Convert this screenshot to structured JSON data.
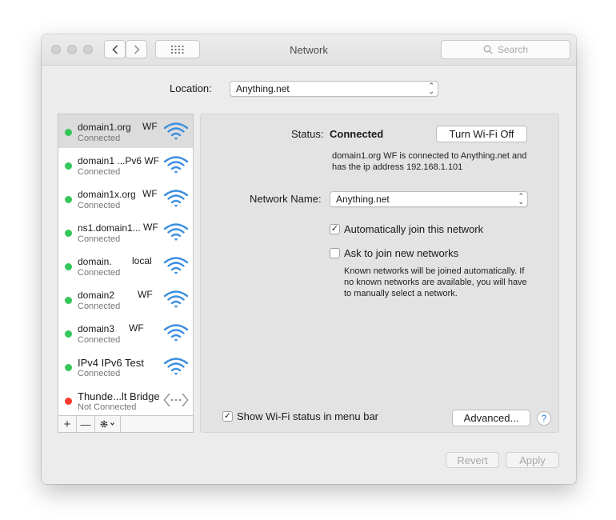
{
  "window": {
    "title": "Network",
    "search_placeholder": "Search"
  },
  "location": {
    "label": "Location:",
    "value": "Anything.net"
  },
  "services": [
    {
      "name": "domain1.org",
      "suffix": "WF",
      "status": "Connected",
      "icon": "wifi-icon",
      "state": "green",
      "selected": true
    },
    {
      "name": "domain1 ...Pv6 WF",
      "suffix": "",
      "status": "Connected",
      "icon": "wifi-icon",
      "state": "green",
      "selected": false
    },
    {
      "name": "domain1x.org",
      "suffix": "WF",
      "status": "Connected",
      "icon": "wifi-icon",
      "state": "green",
      "selected": false
    },
    {
      "name": "ns1.domain1...",
      "suffix": "WF",
      "status": "Connected",
      "icon": "wifi-icon",
      "state": "green",
      "selected": false
    },
    {
      "name": "domain.",
      "suffix": "local",
      "status": "Connected",
      "icon": "wifi-icon",
      "state": "green",
      "selected": false
    },
    {
      "name": "domain2",
      "suffix": "WF",
      "status": "Connected",
      "icon": "wifi-icon",
      "state": "green",
      "selected": false
    },
    {
      "name": "domain3",
      "suffix": "WF",
      "status": "Connected",
      "icon": "wifi-icon",
      "state": "green",
      "selected": false
    },
    {
      "name": "IPv4 IPv6 Test",
      "suffix": "",
      "status": "Connected",
      "icon": "wifi-icon",
      "state": "green",
      "selected": false
    },
    {
      "name": "Thunde...lt Bridge",
      "suffix": "",
      "status": "Not Connected",
      "icon": "thunderbolt-bridge-icon",
      "state": "red",
      "selected": false
    }
  ],
  "list_footer": {
    "add": "+",
    "remove": "—"
  },
  "detail": {
    "status_label": "Status:",
    "status_value": "Connected",
    "turn_off_button": "Turn Wi-Fi Off",
    "status_desc_line1": "domain1.org WF is connected to Anything.net and",
    "status_desc_line2": "has the ip address 192.168.1.101",
    "network_name_label": "Network Name:",
    "network_name_value": "Anything.net",
    "auto_join_label": "Automatically join this network",
    "auto_join_checked": true,
    "ask_join_label": "Ask to join new networks",
    "ask_join_checked": false,
    "ask_desc_line1": "Known networks will be joined automatically. If",
    "ask_desc_line2": "no known networks are available, you will have",
    "ask_desc_line3": "to manually select a network.",
    "show_status_label": "Show Wi-Fi status in menu bar",
    "show_status_checked": true,
    "advanced_button": "Advanced...",
    "help": "?"
  },
  "footer": {
    "revert": "Revert",
    "apply": "Apply"
  },
  "colors": {
    "connected": "#34c759",
    "not_connected": "#ff3b30",
    "wifi": "#3b8fe0"
  }
}
